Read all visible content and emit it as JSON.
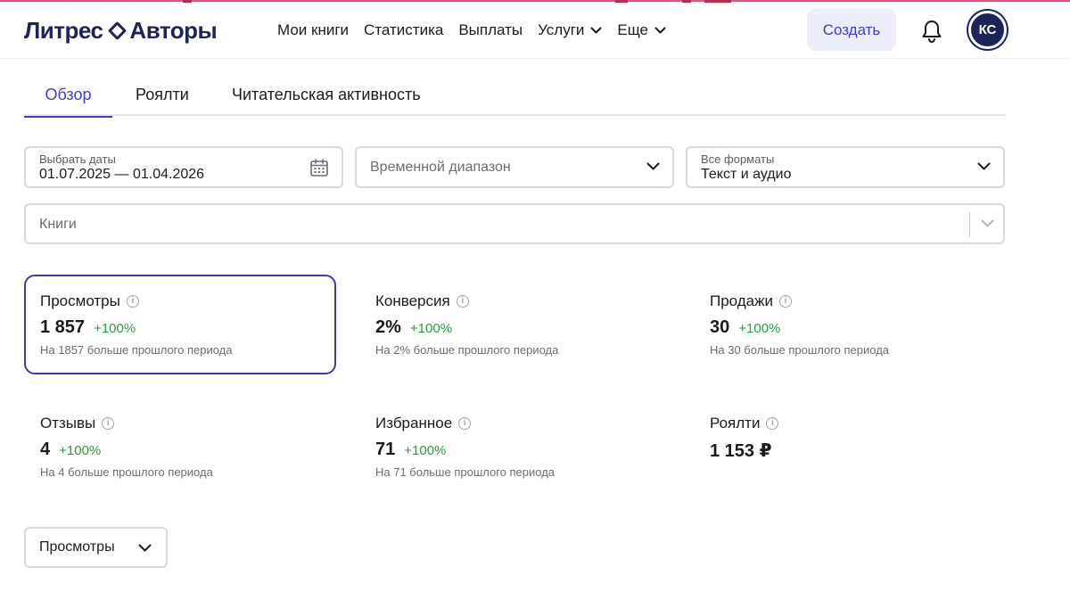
{
  "header": {
    "logo_part1": "Литрес",
    "logo_part2": "Авторы",
    "nav": [
      {
        "label": "Мои книги"
      },
      {
        "label": "Статистика"
      },
      {
        "label": "Выплаты"
      },
      {
        "label": "Услуги"
      },
      {
        "label": "Еще"
      }
    ],
    "create_label": "Создать",
    "avatar_initials": "КС"
  },
  "tabs": [
    {
      "label": "Обзор",
      "active": true
    },
    {
      "label": "Роялти",
      "active": false
    },
    {
      "label": "Читательская активность",
      "active": false
    }
  ],
  "filters": {
    "date": {
      "label": "Выбрать даты",
      "value": "01.07.2025 — 01.04.2026"
    },
    "range": {
      "placeholder": "Временной диапазон"
    },
    "format": {
      "label": "Все форматы",
      "value": "Текст и аудио"
    },
    "books": {
      "placeholder": "Книги"
    }
  },
  "stats": [
    {
      "title": "Просмотры",
      "value": "1 857",
      "delta": "+100%",
      "note": "На 1857 больше прошлого периода"
    },
    {
      "title": "Конверсия",
      "value": "2%",
      "delta": "+100%",
      "note": "На 2% больше прошлого периода"
    },
    {
      "title": "Продажи",
      "value": "30",
      "delta": "+100%",
      "note": "На 30 больше прошлого периода"
    },
    {
      "title": "Отзывы",
      "value": "4",
      "delta": "+100%",
      "note": "На 4 больше прошлого периода"
    },
    {
      "title": "Избранное",
      "value": "71",
      "delta": "+100%",
      "note": "На 71 больше прошлого периода"
    },
    {
      "title": "Роялти",
      "value": "1 153 ₽"
    }
  ],
  "metric_select": {
    "value": "Просмотры"
  },
  "colors": {
    "accent": "#3d3dd6",
    "brand_navy": "#1d2459",
    "brand_orange": "#ff5a23",
    "positive": "#2e9a3f"
  }
}
